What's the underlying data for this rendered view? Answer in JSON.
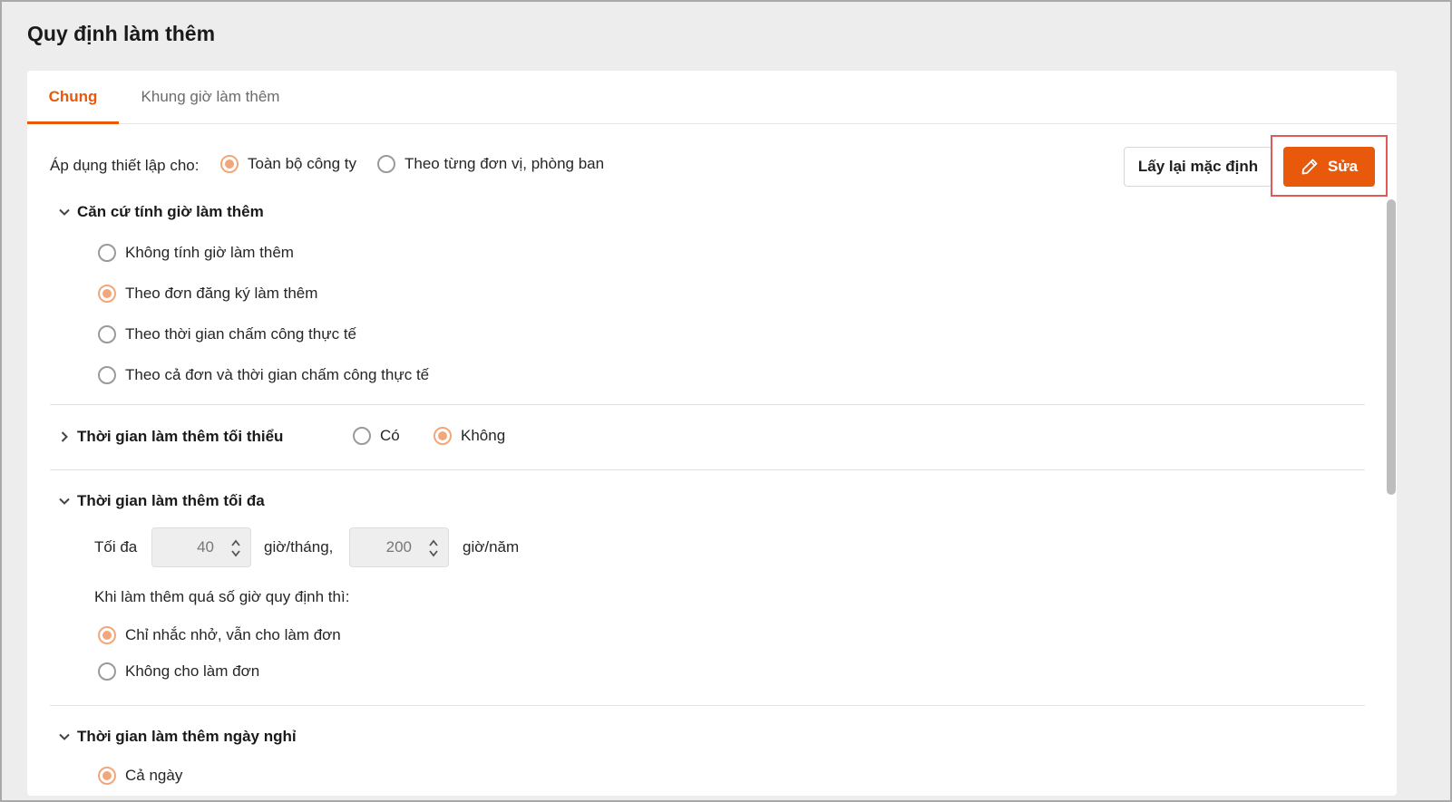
{
  "page": {
    "title": "Quy định làm thêm"
  },
  "tabs": [
    {
      "label": "Chung",
      "active": true
    },
    {
      "label": "Khung giờ làm thêm",
      "active": false
    }
  ],
  "apply": {
    "label": "Áp dụng thiết lập cho:",
    "options": [
      {
        "label": "Toàn bộ công ty",
        "checked": true
      },
      {
        "label": "Theo từng đơn vị, phòng ban",
        "checked": false
      }
    ]
  },
  "buttons": {
    "reset_label": "Lấy lại mặc định",
    "edit_label": "Sửa"
  },
  "section_basis": {
    "title": "Căn cứ tính giờ làm thêm",
    "options": [
      {
        "label": "Không tính giờ làm thêm",
        "checked": false
      },
      {
        "label": "Theo đơn đăng ký làm thêm",
        "checked": true
      },
      {
        "label": "Theo thời gian chấm công thực tế",
        "checked": false
      },
      {
        "label": "Theo cả đơn và thời gian chấm công thực tế",
        "checked": false
      }
    ]
  },
  "section_min": {
    "title": "Thời gian làm thêm tối thiểu",
    "options": [
      {
        "label": "Có",
        "checked": false
      },
      {
        "label": "Không",
        "checked": true
      }
    ]
  },
  "section_max": {
    "title": "Thời gian làm thêm tối đa",
    "max_label": "Tối đa",
    "month_value": "40",
    "month_unit": "giờ/tháng,",
    "year_value": "200",
    "year_unit": "giờ/năm",
    "exceed_label": "Khi làm thêm quá số giờ quy định thì:",
    "options": [
      {
        "label": "Chỉ nhắc nhở, vẫn cho làm đơn",
        "checked": true
      },
      {
        "label": "Không cho làm đơn",
        "checked": false
      }
    ]
  },
  "section_holiday": {
    "title": "Thời gian làm thêm ngày nghỉ",
    "options": [
      {
        "label": "Cả ngày",
        "checked": true
      }
    ]
  },
  "colors": {
    "accent": "#e8590c",
    "radio_checked": "#f2a77a",
    "highlight_frame": "#e05a5a"
  }
}
